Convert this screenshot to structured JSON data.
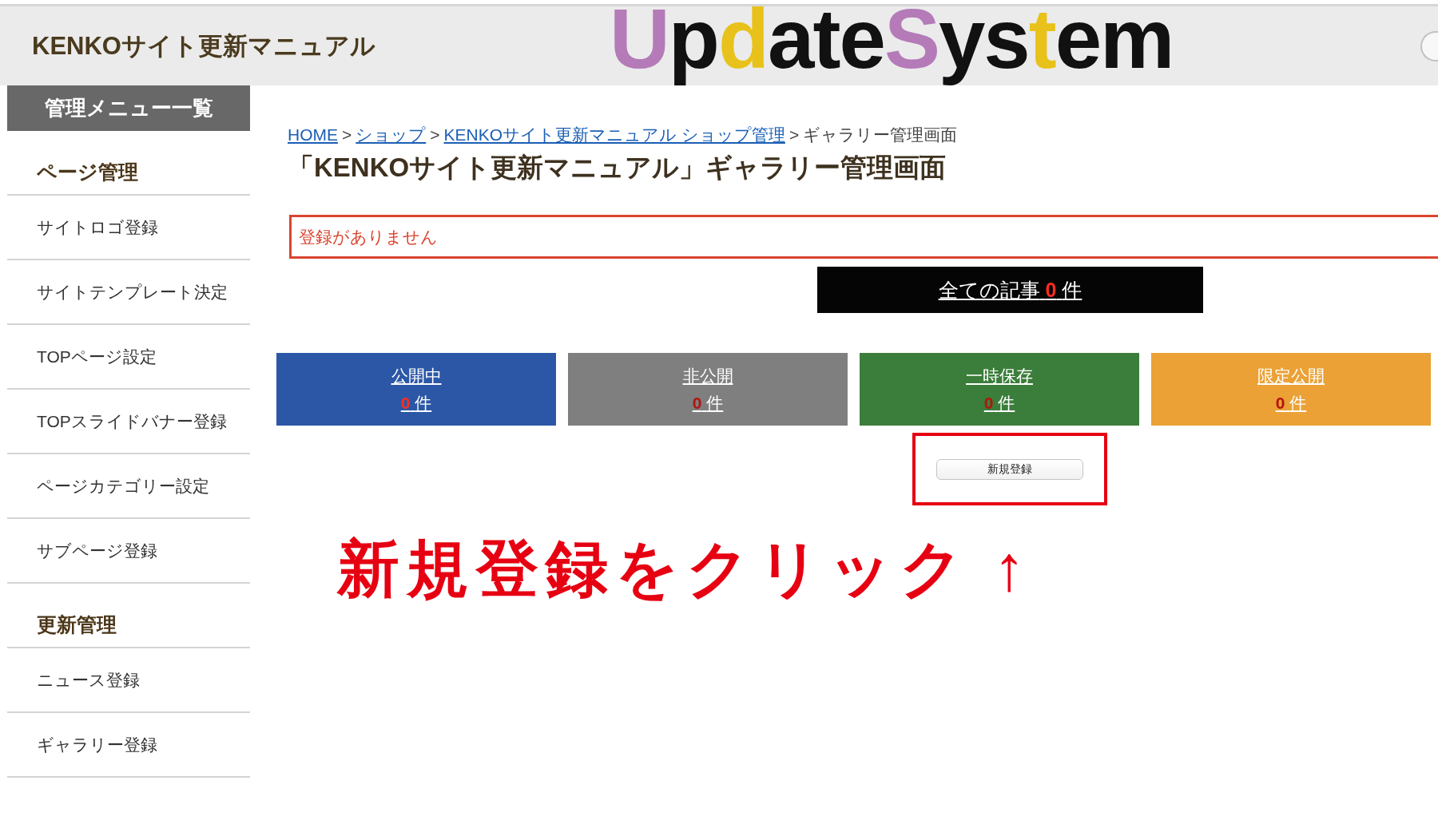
{
  "header": {
    "site_title": "KENKOサイト更新マニュアル",
    "logo": [
      {
        "text": "U",
        "color": "#b47bb8"
      },
      {
        "text": "p"
      },
      {
        "text": "d",
        "color": "#e8c21a"
      },
      {
        "text": "ate"
      },
      {
        "text": "S",
        "color": "#b47bb8"
      },
      {
        "text": "ys"
      },
      {
        "text": "t",
        "color": "#e8c21a"
      },
      {
        "text": "em"
      }
    ],
    "search_field": true
  },
  "sidebar": {
    "title": "管理メニュー一覧",
    "sections": [
      {
        "heading": "ページ管理",
        "items": [
          "サイトロゴ登録",
          "サイトテンプレート決定",
          "TOPページ設定",
          "TOPスライドバナー登録",
          "ページカテゴリー設定",
          "サブページ登録"
        ]
      },
      {
        "heading": "更新管理",
        "items": [
          "ニュース登録",
          "ギャラリー登録"
        ]
      }
    ]
  },
  "breadcrumb": {
    "separator": ">",
    "items": [
      {
        "label": "HOME",
        "kind": "link"
      },
      {
        "label": "ショップ",
        "kind": "link"
      },
      {
        "label": "KENKOサイト更新マニュアル ショップ管理",
        "kind": "link"
      },
      {
        "label": "ギャラリー管理画面",
        "kind": "current"
      }
    ]
  },
  "page_title": "「KENKOサイト更新マニュアル」ギャラリー管理画面",
  "alert": "登録がありません",
  "total_button": {
    "label": "全ての記事",
    "count": "0",
    "unit": "件"
  },
  "status_tiles": [
    {
      "label": "公開中",
      "count": "0",
      "unit": "件",
      "color": "#2b57a6"
    },
    {
      "label": "非公開",
      "count": "0",
      "unit": "件",
      "color": "#7f7f7f"
    },
    {
      "label": "一時保存",
      "count": "0",
      "unit": "件",
      "color": "#3b7d3b"
    },
    {
      "label": "限定公開",
      "count": "0",
      "unit": "件",
      "color": "#eba135"
    }
  ],
  "new_button": {
    "label": "新規登録",
    "highlighted": true
  },
  "annotation": {
    "text": "新規登録をクリック",
    "arrow": "↑"
  }
}
